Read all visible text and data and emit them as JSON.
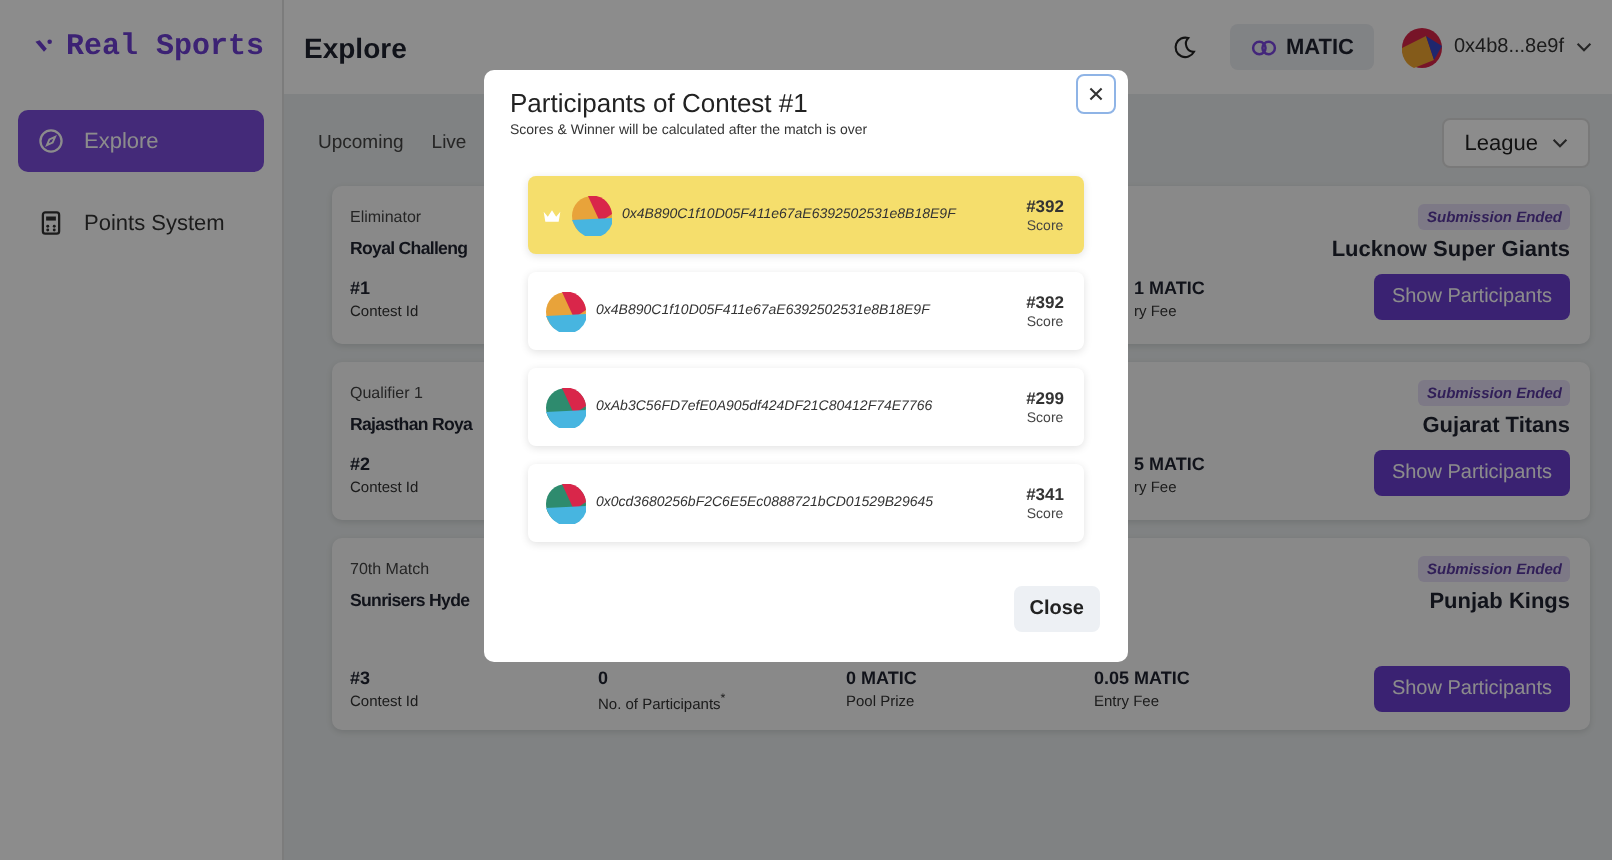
{
  "sidebar": {
    "logo": "Real Sports",
    "items": [
      {
        "label": "Explore",
        "kind": "compass",
        "selected": true
      },
      {
        "label": "Points System",
        "kind": "calculator",
        "selected": false
      }
    ]
  },
  "header": {
    "title": "Explore",
    "network": "MATIC",
    "account": "0x4b8...8e9f"
  },
  "tabs": [
    {
      "label": "Upcoming",
      "selected": false
    },
    {
      "label": "Live",
      "selected": false
    }
  ],
  "filter": {
    "label": "League"
  },
  "contests": [
    {
      "stage": "Eliminator",
      "team_left": "Royal Challeng",
      "team_right": "Lucknow Super Giants",
      "status": "Submission Ended",
      "contest": {
        "value": "#1",
        "label": "Contest Id"
      },
      "fee": {
        "value": "1 MATIC",
        "label": "ry Fee"
      },
      "button": "Show Participants"
    },
    {
      "stage": "Qualifier 1",
      "team_left": "Rajasthan Roya",
      "team_right": "Gujarat Titans",
      "status": "Submission Ended",
      "contest": {
        "value": "#2",
        "label": "Contest Id"
      },
      "fee": {
        "value": "5 MATIC",
        "label": "ry Fee"
      },
      "button": "Show Participants"
    },
    {
      "stage": "70th Match",
      "team_left": "Sunrisers Hyde",
      "team_right": "Punjab Kings",
      "status": "Submission Ended",
      "contest": {
        "value": "#3",
        "label": "Contest Id"
      },
      "participants": {
        "value": "0",
        "label": "No. of Participants$^{*}$"
      },
      "pool": {
        "value": "0 MATIC",
        "label": "Pool Prize"
      },
      "fee": {
        "value": "0.05 MATIC",
        "label": "Entry Fee"
      },
      "button": "Show Participants"
    }
  ],
  "modal": {
    "title": "Participants of Contest #1",
    "subtitle": "Scores & Winner will be calculated after the match is over",
    "close": "Close",
    "participants": [
      {
        "address": "0x4B890C1f10D05F411e67aE6392502531e8B18E9F",
        "rank": "#392",
        "rank_label": "Score",
        "winner": true,
        "color": "#e8a33a"
      },
      {
        "address": "0x4B890C1f10D05F411e67aE6392502531e8B18E9F",
        "rank": "#392",
        "rank_label": "Score",
        "winner": false,
        "color": "#e8a33a"
      },
      {
        "address": "0xAb3C56FD7efE0A905df424DF21C80412F74E7766",
        "rank": "#299",
        "rank_label": "Score",
        "winner": false,
        "color": "#2e8b6e"
      },
      {
        "address": "0x0cd3680256bF2C6E5Ec0888721bCD01529B29645",
        "rank": "#341",
        "rank_label": "Score",
        "winner": false,
        "color": "#2e8b6e"
      }
    ]
  }
}
